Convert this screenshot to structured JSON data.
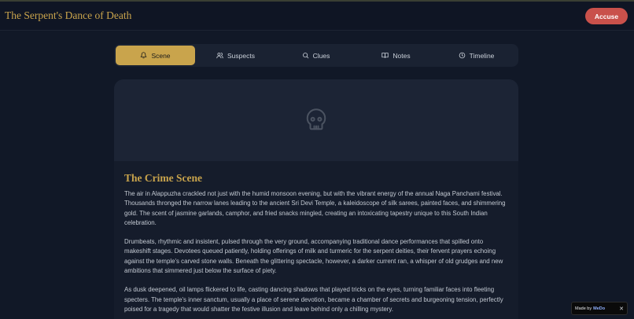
{
  "header": {
    "title": "The Serpent's Dance of Death",
    "accuse_label": "Accuse"
  },
  "tabs": [
    {
      "label": "Scene",
      "icon": "bell-icon",
      "active": true
    },
    {
      "label": "Suspects",
      "icon": "users-icon",
      "active": false
    },
    {
      "label": "Clues",
      "icon": "search-icon",
      "active": false
    },
    {
      "label": "Notes",
      "icon": "book-icon",
      "active": false
    },
    {
      "label": "Timeline",
      "icon": "clock-icon",
      "active": false
    }
  ],
  "scene": {
    "hero_icon": "skull-icon",
    "title": "The Crime Scene",
    "paragraphs": [
      "The air in Alappuzha crackled not just with the humid monsoon evening, but with the vibrant energy of the annual Naga Panchami festival. Thousands thronged the narrow lanes leading to the ancient Sri Devi Temple, a kaleidoscope of silk sarees, painted faces, and shimmering gold. The scent of jasmine garlands, camphor, and fried snacks mingled, creating an intoxicating tapestry unique to this South Indian celebration.",
      "Drumbeats, rhythmic and insistent, pulsed through the very ground, accompanying traditional dance performances that spilled onto makeshift stages. Devotees queued patiently, holding offerings of milk and turmeric for the serpent deities, their fervent prayers echoing against the temple's carved stone walls. Beneath the glittering spectacle, however, a darker current ran, a whisper of old grudges and new ambitions that simmered just below the surface of piety.",
      "As dusk deepened, oil lamps flickered to life, casting dancing shadows that played tricks on the eyes, turning familiar faces into fleeting specters. The temple's inner sanctum, usually a place of serene devotion, became a chamber of secrets and burgeoning tension, perfectly poised for a tragedy that would shatter the festive illusion and leave behind only a chilling mystery."
    ]
  },
  "badge": {
    "made_by": "Made by",
    "brand": "MeDo",
    "close": "✕"
  },
  "colors": {
    "accent": "#c9a44c",
    "danger": "#c9514b",
    "background": "#111827"
  }
}
